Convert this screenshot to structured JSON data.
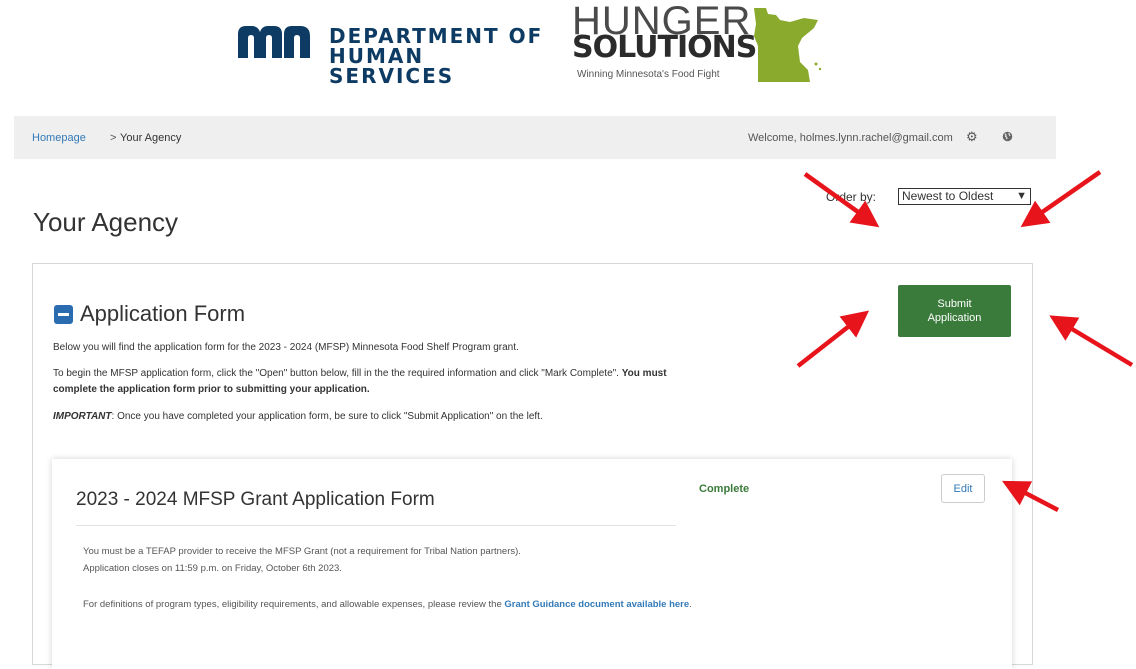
{
  "header": {
    "dhs_logo": {
      "line1": "DEPARTMENT OF",
      "line2": "HUMAN SERVICES"
    },
    "hunger_logo": {
      "line1": "HUNGER",
      "line2": "SOLUTIONS",
      "tagline": "Winning Minnesota's Food Fight"
    }
  },
  "nav": {
    "breadcrumb_home": "Homepage",
    "breadcrumb_sep": ">",
    "breadcrumb_current": "Your Agency",
    "welcome": "Welcome, holmes.lynn.rachel@gmail.com"
  },
  "page": {
    "title": "Your Agency",
    "order_label": "Order by:",
    "order_value": "Newest to Oldest"
  },
  "section": {
    "title": "Application Form",
    "intro": "Below you will find the application form for the 2023 - 2024 (MFSP) Minnesota Food Shelf Program grant.",
    "instr_part1": "To begin the MFSP application form, click the \"Open\" button below, fill in the the required information and click \"Mark Complete\". ",
    "instr_bold": "You must complete the application form prior to submitting your application.",
    "important_label": "IMPORTANT",
    "important_text": ": Once you have completed your application form, be sure to click \"Submit Application\" on the left.",
    "submit_line1": "Submit",
    "submit_line2": "Application"
  },
  "card": {
    "title": "2023 - 2024 MFSP Grant Application Form",
    "status": "Complete",
    "edit_label": "Edit",
    "para1_line1": "You must be a TEFAP provider to receive the MFSP Grant (not a requirement for Tribal Nation partners).",
    "para1_line2": "Application closes on 11:59 p.m. on Friday, October 6th 2023.",
    "para2_text": "For definitions of program types, eligibility requirements, and allowable expenses, please review the ",
    "para2_link": "Grant Guidance document available here",
    "para2_end": "."
  },
  "colors": {
    "accent_green": "#3a7a3a",
    "link_blue": "#337ab7",
    "annotation_red": "#e8141b"
  },
  "icons": [
    "mn-logo-icon",
    "minnesota-state-icon",
    "gear-icon",
    "globe-icon",
    "minus-collapse-icon",
    "chevron-down-icon",
    "red-arrow-icon"
  ]
}
